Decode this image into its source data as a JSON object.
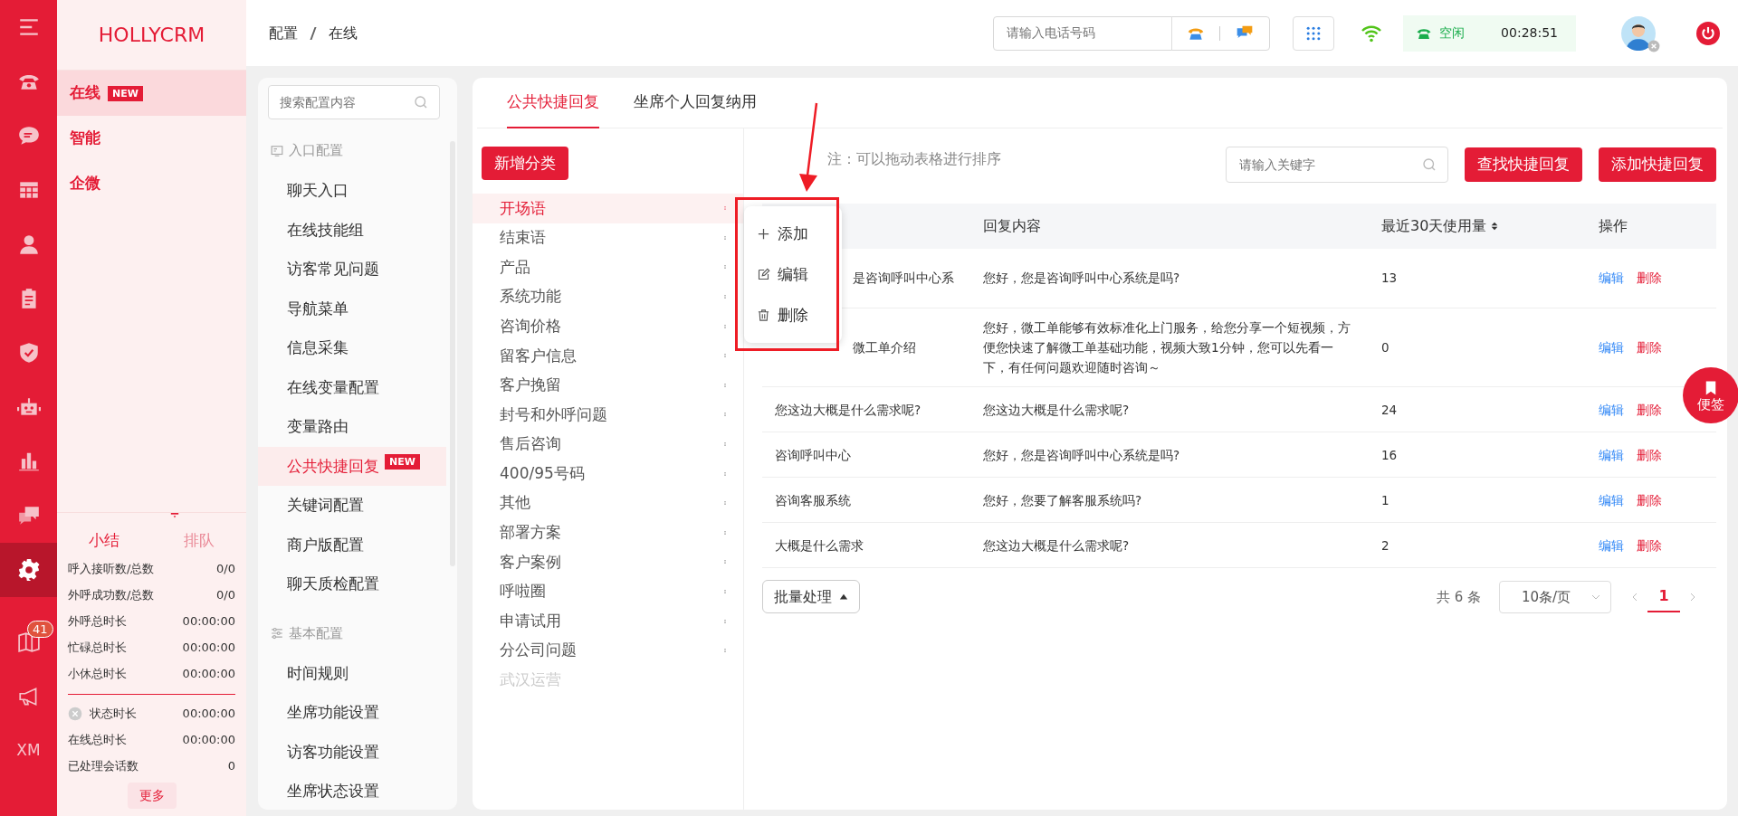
{
  "rail": {
    "items": [
      {
        "kind": "menu",
        "selected": false
      },
      {
        "kind": "phone",
        "selected": false
      },
      {
        "kind": "chat",
        "selected": false
      },
      {
        "kind": "grid",
        "selected": false
      },
      {
        "kind": "person",
        "selected": false
      },
      {
        "kind": "clipboard",
        "selected": false
      },
      {
        "kind": "shield",
        "selected": false
      },
      {
        "kind": "robot",
        "selected": false
      },
      {
        "kind": "chart",
        "selected": false
      },
      {
        "kind": "comments",
        "selected": false
      },
      {
        "kind": "gear",
        "selected": true
      },
      {
        "kind": "book",
        "selected": false,
        "badge": "41"
      },
      {
        "kind": "megaphone",
        "selected": false
      },
      {
        "kind": "text",
        "selected": false,
        "label": "XM"
      }
    ]
  },
  "sidebar": {
    "logo": "HOLLYCRM",
    "items": [
      {
        "label": "在线",
        "selected": true,
        "badge": "NEW"
      },
      {
        "label": "智能",
        "selected": false
      },
      {
        "label": "企微",
        "selected": false
      }
    ],
    "summary_tabs": [
      {
        "label": "小结",
        "selected": true
      },
      {
        "label": "排队",
        "selected": false
      }
    ],
    "stat_groups": [
      [
        {
          "kind": "plain",
          "label": "呼入接听数/总数",
          "value": "0/0"
        },
        {
          "kind": "plain",
          "label": "外呼成功数/总数",
          "value": "0/0"
        },
        {
          "kind": "plain",
          "label": "外呼总时长",
          "value": "00:00:00"
        },
        {
          "kind": "plain",
          "label": "忙碌总时长",
          "value": "00:00:00"
        },
        {
          "kind": "plain",
          "label": "小休总时长",
          "value": "00:00:00"
        }
      ],
      [
        {
          "kind": "status",
          "label": "状态时长",
          "value": "00:00:00"
        },
        {
          "kind": "plain",
          "label": "在线总时长",
          "value": "00:00:00"
        },
        {
          "kind": "plain",
          "label": "已处理会话数",
          "value": "0"
        }
      ]
    ],
    "more_button": "更多"
  },
  "header": {
    "breadcrumb": [
      "配置",
      "在线"
    ],
    "phone_field": {
      "placeholder": "请输入电话号码"
    },
    "status": "空闲",
    "timer": "00:28:51"
  },
  "config_menu": {
    "search": {
      "placeholder": "搜索配置内容"
    },
    "sections": [
      {
        "title": "入口配置",
        "kind": "entry",
        "items": [
          {
            "label": "聊天入口",
            "selected": false
          },
          {
            "label": "在线技能组",
            "selected": false
          },
          {
            "label": "访客常见问题",
            "selected": false
          },
          {
            "label": "导航菜单",
            "selected": false
          },
          {
            "label": "信息采集",
            "selected": false
          },
          {
            "label": "在线变量配置",
            "selected": false
          },
          {
            "label": "变量路由",
            "selected": false
          },
          {
            "label": "公共快捷回复",
            "selected": true,
            "badge": "NEW"
          },
          {
            "label": "关键词配置",
            "selected": false
          },
          {
            "label": "商户版配置",
            "selected": false
          },
          {
            "label": "聊天质检配置",
            "selected": false
          }
        ]
      },
      {
        "title": "基本配置",
        "kind": "basic",
        "items": [
          {
            "label": "时间规则",
            "selected": false
          },
          {
            "label": "坐席功能设置",
            "selected": false
          },
          {
            "label": "访客功能设置",
            "selected": false
          },
          {
            "label": "坐席状态设置",
            "selected": false
          }
        ]
      }
    ]
  },
  "tabs": [
    {
      "label": "公共快捷回复",
      "selected": true
    },
    {
      "label": "坐席个人回复纳用",
      "selected": false
    }
  ],
  "categories": {
    "add_button": "新增分类",
    "items": [
      {
        "label": "开场语",
        "selected": true,
        "disabled": false
      },
      {
        "label": "结束语",
        "selected": false,
        "disabled": false
      },
      {
        "label": "产品",
        "selected": false,
        "disabled": false
      },
      {
        "label": "系统功能",
        "selected": false,
        "disabled": false
      },
      {
        "label": "咨询价格",
        "selected": false,
        "disabled": false
      },
      {
        "label": "留客户信息",
        "selected": false,
        "disabled": false
      },
      {
        "label": "客户挽留",
        "selected": false,
        "disabled": false
      },
      {
        "label": "封号和外呼问题",
        "selected": false,
        "disabled": false
      },
      {
        "label": "售后咨询",
        "selected": false,
        "disabled": false
      },
      {
        "label": "400/95号码",
        "selected": false,
        "disabled": false
      },
      {
        "label": "其他",
        "selected": false,
        "disabled": false
      },
      {
        "label": "部署方案",
        "selected": false,
        "disabled": false
      },
      {
        "label": "客户案例",
        "selected": false,
        "disabled": false
      },
      {
        "label": "呼啦圈",
        "selected": false,
        "disabled": false
      },
      {
        "label": "申请试用",
        "selected": false,
        "disabled": false
      },
      {
        "label": "分公司问题",
        "selected": false,
        "disabled": false
      },
      {
        "label": "武汉运营",
        "selected": false,
        "disabled": true
      }
    ]
  },
  "context_menu": {
    "items": [
      {
        "kind": "add",
        "label": "添加"
      },
      {
        "kind": "edit",
        "label": "编辑"
      },
      {
        "kind": "delete",
        "label": "删除"
      }
    ]
  },
  "toolbar": {
    "note": "注：可以拖动表格进行排序",
    "search": {
      "placeholder": "请输入关键字"
    },
    "buttons": [
      "查找快捷回复",
      "添加快捷回复"
    ]
  },
  "table": {
    "columns": [
      "回复内容",
      "最近30天使用量",
      "操作"
    ],
    "rows": [
      {
        "title": "是咨询呼叫中心系",
        "content": "您好，您是咨询呼叫中心系统是吗?",
        "usage": "13",
        "actions": [
          "编辑",
          "删除"
        ]
      },
      {
        "title": "微工单介绍",
        "content": "您好，微工单能够有效标准化上门服务，给您分享一个短视频，方便您快速了解微工单基础功能，视频大致1分钟，您可以先看一下，有任何问题欢迎随时咨询～",
        "usage": "0",
        "actions": [
          "编辑",
          "删除"
        ]
      },
      {
        "title": "您这边大概是什么需求呢?",
        "content": "您这边大概是什么需求呢?",
        "usage": "24",
        "actions": [
          "编辑",
          "删除"
        ]
      },
      {
        "title": "咨询呼叫中心",
        "content": "您好，您是咨询呼叫中心系统是吗?",
        "usage": "16",
        "actions": [
          "编辑",
          "删除"
        ]
      },
      {
        "title": "咨询客服系统",
        "content": "您好，您要了解客服系统吗?",
        "usage": "1",
        "actions": [
          "编辑",
          "删除"
        ]
      },
      {
        "title": "大概是什么需求",
        "content": "您这边大概是什么需求呢?",
        "usage": "2",
        "actions": [
          "编辑",
          "删除"
        ]
      }
    ]
  },
  "footer": {
    "batch_button": "批量处理",
    "total": "共 6 条",
    "page_size": "10条/页",
    "pages": [
      {
        "label": "1",
        "selected": true
      }
    ]
  },
  "float_button": "便签"
}
